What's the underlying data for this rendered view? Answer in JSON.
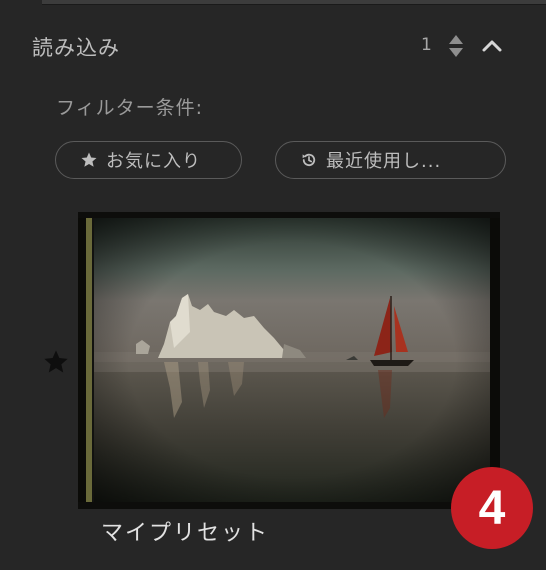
{
  "section": {
    "title": "読み込み",
    "count": "1",
    "stepper_icon": "up-down-stepper-icon",
    "collapse_icon": "chevron-up-icon"
  },
  "filter": {
    "label": "フィルター条件:",
    "buttons": [
      {
        "label": "お気に入り",
        "icon": "star-icon"
      },
      {
        "label": "最近使用し...",
        "icon": "recent-clock-icon"
      }
    ]
  },
  "preset": {
    "name": "マイプリセット",
    "favorite_icon": "star-icon",
    "thumbnail_alt": "iceberg-and-red-sailboat-photo"
  },
  "badge": {
    "number": "4",
    "color": "#c71e26"
  },
  "colors": {
    "background": "#262626",
    "pill_border": "#5a5a5a",
    "text": "#bdbdbd",
    "accent_red": "#c71e26"
  }
}
